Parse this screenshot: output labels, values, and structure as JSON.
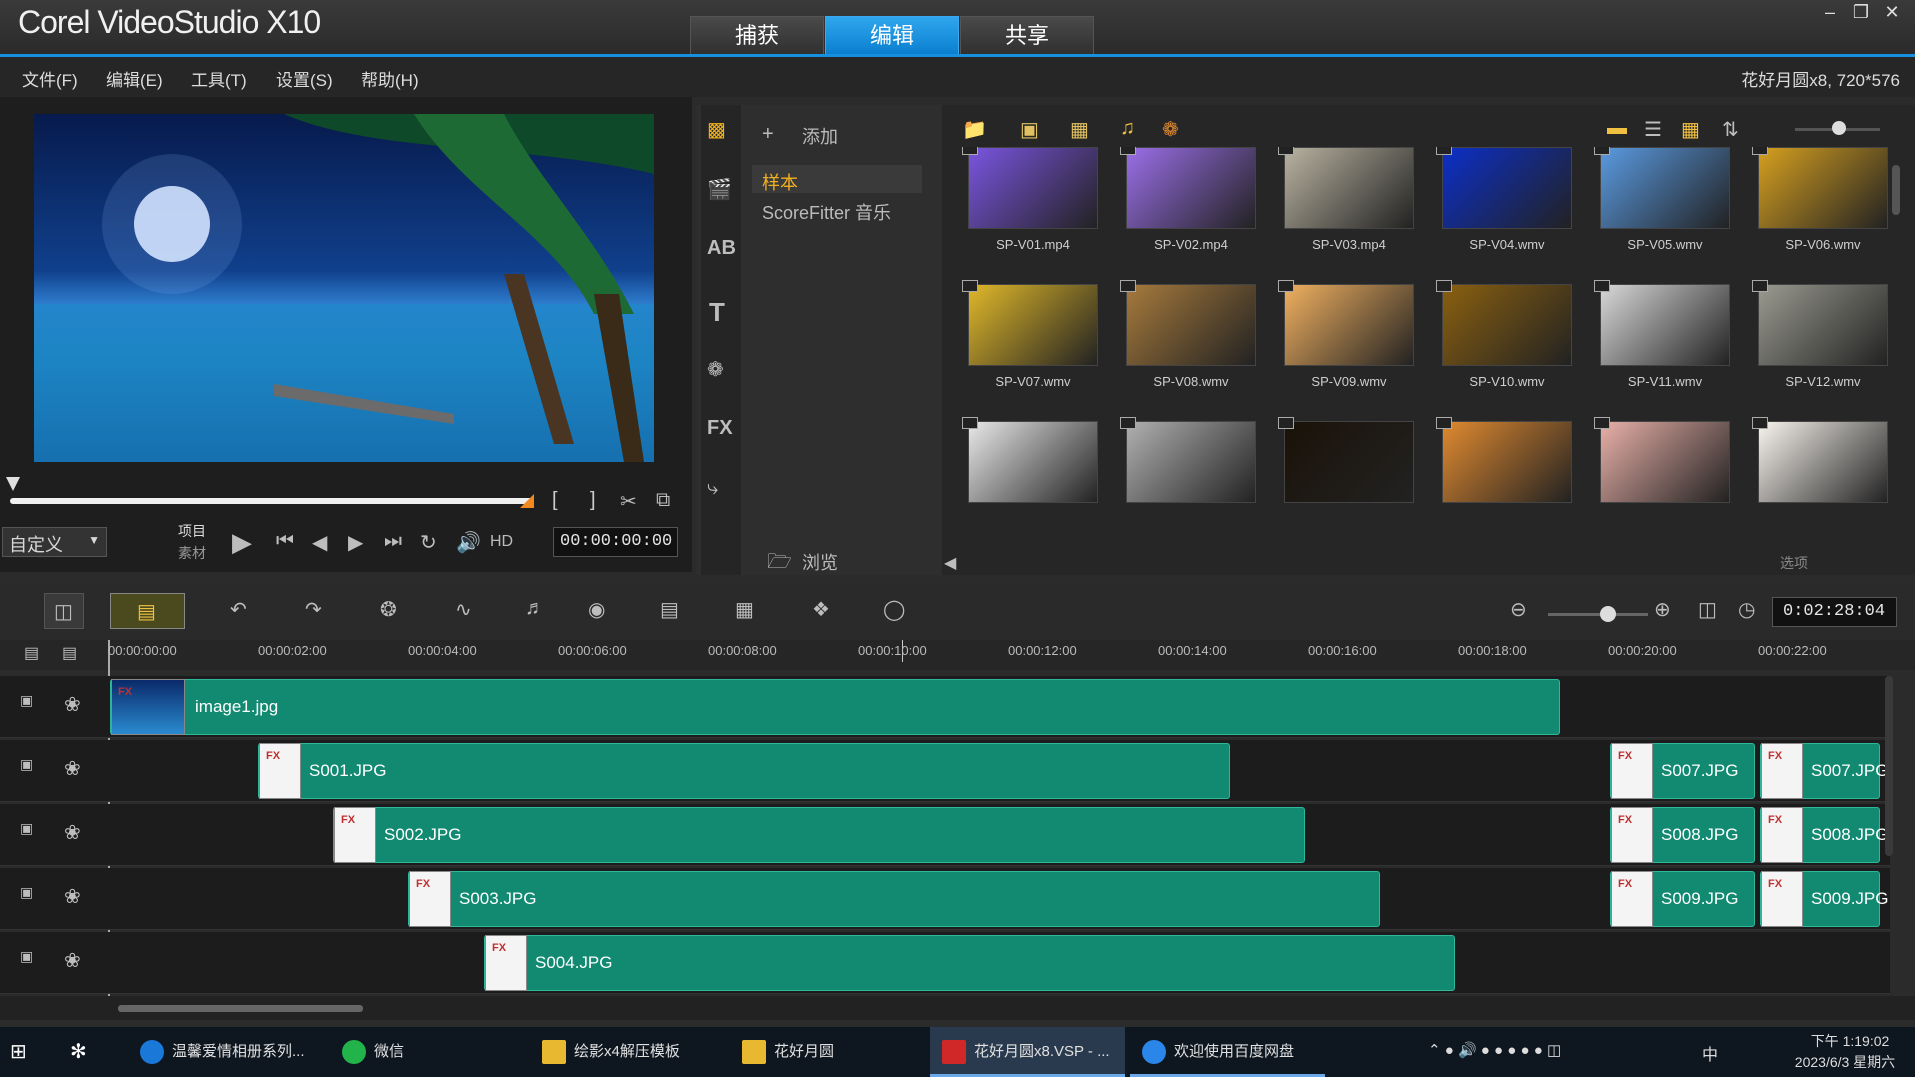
{
  "app": {
    "title": "Corel VideoStudio X10"
  },
  "main_tabs": [
    "捕获",
    "编辑",
    "共享"
  ],
  "menu": [
    "文件(F)",
    "编辑(E)",
    "工具(T)",
    "设置(S)",
    "帮助(H)"
  ],
  "project_info": "花好月圆x8, 720*576",
  "preview": {
    "mode_select": "自定义",
    "project_label": "项目",
    "clip_label": "素材",
    "hd_label": "HD",
    "timecode": "00:00:00:00",
    "brackets": [
      "[",
      "]"
    ]
  },
  "library": {
    "add_label": "添加",
    "folders": [
      "样本",
      "ScoreFitter 音乐"
    ],
    "browse_label": "浏览",
    "options_label": "选项",
    "items": [
      {
        "name": "SP-V01.mp4",
        "color": "#7a55e0"
      },
      {
        "name": "SP-V02.mp4",
        "color": "#9a6fe8"
      },
      {
        "name": "SP-V03.mp4",
        "color": "#b8b2a0"
      },
      {
        "name": "SP-V04.wmv",
        "color": "#0c2fc8"
      },
      {
        "name": "SP-V05.wmv",
        "color": "#5a9ae0"
      },
      {
        "name": "SP-V06.wmv",
        "color": "#d6a020"
      },
      {
        "name": "SP-V07.wmv",
        "color": "#e0b82a"
      },
      {
        "name": "SP-V08.wmv",
        "color": "#a67a3c"
      },
      {
        "name": "SP-V09.wmv",
        "color": "#f0b060"
      },
      {
        "name": "SP-V10.wmv",
        "color": "#8a6010"
      },
      {
        "name": "SP-V11.wmv",
        "color": "#d8d8d8"
      },
      {
        "name": "SP-V12.wmv",
        "color": "#9a9a90"
      },
      {
        "name": "",
        "color": "#e8e8e8"
      },
      {
        "name": "",
        "color": "#b0b0b0"
      },
      {
        "name": "",
        "color": "#1a1208"
      },
      {
        "name": "",
        "color": "#e08a30"
      },
      {
        "name": "",
        "color": "#e8b0a8"
      },
      {
        "name": "",
        "color": "#f8f4ee"
      }
    ]
  },
  "timeline": {
    "duration": "0:02:28:04",
    "ruler": [
      "00:00:00:00",
      "00:00:02:00",
      "00:00:04:00",
      "00:00:06:00",
      "00:00:08:00",
      "00:00:10:00",
      "00:00:12:00",
      "00:00:14:00",
      "00:00:16:00",
      "00:00:18:00",
      "00:00:20:00",
      "00:00:22:00"
    ],
    "tracks": [
      {
        "clips": [
          {
            "label": "image1.jpg"
          }
        ]
      },
      {
        "clips": [
          {
            "label": "S001.JPG"
          },
          {
            "label": "S007.JPG"
          },
          {
            "label": "S007.JPG"
          }
        ]
      },
      {
        "clips": [
          {
            "label": "S002.JPG"
          },
          {
            "label": "S008.JPG"
          },
          {
            "label": "S008.JPG"
          }
        ]
      },
      {
        "clips": [
          {
            "label": "S003.JPG"
          },
          {
            "label": "S009.JPG"
          },
          {
            "label": "S009.JPG"
          }
        ]
      },
      {
        "clips": [
          {
            "label": "S004.JPG"
          }
        ]
      }
    ]
  },
  "taskbar": {
    "items": [
      "温馨爱情相册系列...",
      "微信",
      "绘影x4解压模板",
      "花好月圆",
      "花好月圆x8.VSP - ...",
      "欢迎使用百度网盘"
    ],
    "tray_lang": "中",
    "time": "下午 1:19:02",
    "date": "2023/6/3 星期六"
  },
  "colors": {
    "accent": "#1890e0",
    "clip": "#128a72"
  }
}
